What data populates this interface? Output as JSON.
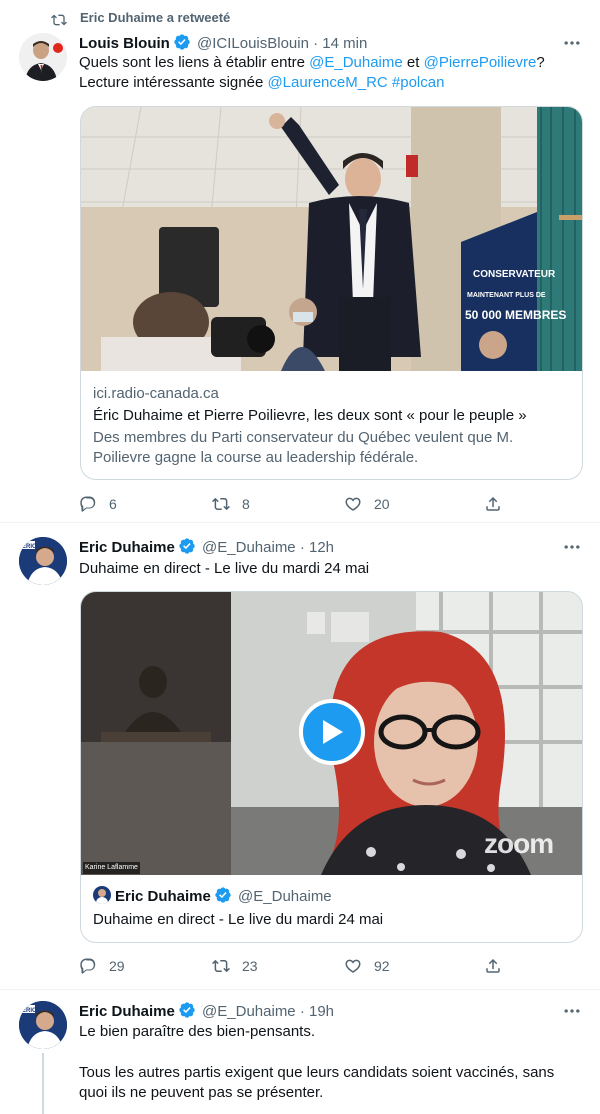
{
  "retweet_header": {
    "text": "Eric Duhaime a retweeté"
  },
  "tweets": [
    {
      "author_name": "Louis Blouin",
      "author_handle": "@ICILouisBlouin",
      "separator": "·",
      "time": "14 min",
      "text_parts": [
        "Quels sont les liens à établir entre ",
        "@E_Duhaime",
        " et ",
        "@PierrePoilievre",
        "? Lecture intéressante signée ",
        "@LaurenceM_RC",
        " ",
        "#polcan"
      ],
      "card": {
        "domain": "ici.radio-canada.ca",
        "title": "Éric Duhaime et Pierre Poilievre, les deux sont « pour le peuple »",
        "description": "Des membres du Parti conservateur du Québec veulent que M. Poilievre gagne la course au leadership fédérale.",
        "sign_line1": "CONSERVATEUR",
        "sign_line2": "MAINTENANT PLUS DE",
        "sign_line3": "50 000 MEMBRES"
      },
      "counts": {
        "replies": "6",
        "retweets": "8",
        "likes": "20"
      }
    },
    {
      "author_name": "Eric Duhaime",
      "author_handle": "@E_Duhaime",
      "separator": "·",
      "time": "12h",
      "text": "Duhaime en direct - Le live du mardi 24 mai",
      "video": {
        "participant_label": "Karine Laflamme",
        "zoom_logo": "zoom",
        "footer_name": "Eric Duhaime",
        "footer_handle": "@E_Duhaime",
        "footer_text": "Duhaime en direct - Le live du mardi 24 mai"
      },
      "counts": {
        "replies": "29",
        "retweets": "23",
        "likes": "92"
      }
    },
    {
      "author_name": "Eric Duhaime",
      "author_handle": "@E_Duhaime",
      "separator": "·",
      "time": "19h",
      "text_line1": "Le bien paraître des bien-pensants.",
      "text_line2": "Tous les autres partis exigent que leurs candidats soient vaccinés, sans quoi ils ne peuvent pas se présenter."
    }
  ],
  "avatar_badge": "ERIC",
  "colors": {
    "accent": "#1d9bf0",
    "text": "#0f1419",
    "muted": "#536471",
    "border": "#cfd9de"
  },
  "icons": [
    "retweet-icon",
    "verified-badge-icon",
    "more-icon",
    "reply-icon",
    "like-icon",
    "share-icon",
    "play-icon"
  ]
}
